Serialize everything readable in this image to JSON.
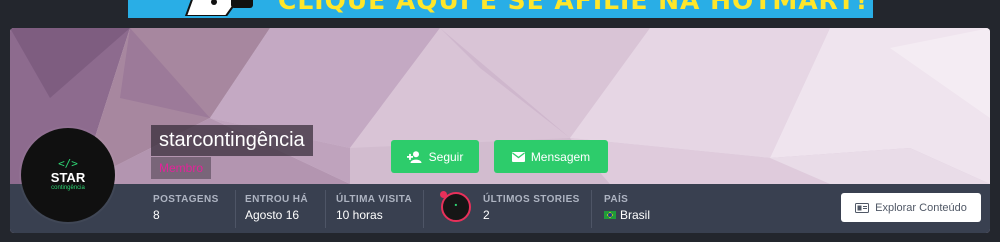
{
  "banner": {
    "text": "CLIQUE AQUI E SE AFILIE NA HOTMART!",
    "background": "#29aee6",
    "text_color": "#ffe62a"
  },
  "profile": {
    "avatar": {
      "code_glyph": "</>",
      "title": "STAR",
      "subtitle": "contingência"
    },
    "username": "starcontingência",
    "role": "Membro"
  },
  "actions": {
    "follow": {
      "label": "Seguir",
      "icon": "user-plus-icon"
    },
    "message": {
      "label": "Mensagem",
      "icon": "envelope-icon"
    },
    "explore": {
      "label": "Explorar Conteúdo",
      "icon": "card-icon"
    }
  },
  "stats": {
    "posts": {
      "label": "POSTAGENS",
      "value": "8"
    },
    "joined": {
      "label": "ENTROU HÁ",
      "value": "Agosto 16"
    },
    "last_visit": {
      "label": "ÚLTIMA VISITA",
      "value": "10 horas"
    },
    "stories": {
      "label": "ÚLTIMOS STORIES",
      "value": "2"
    },
    "country": {
      "label": "PAÍS",
      "value": "Brasil",
      "flag": "brazil-flag-icon"
    }
  },
  "colors": {
    "green": "#2dcc6b",
    "stats_bar": "#394050",
    "role": "#e3239a",
    "story_ring": "#e8305a"
  }
}
